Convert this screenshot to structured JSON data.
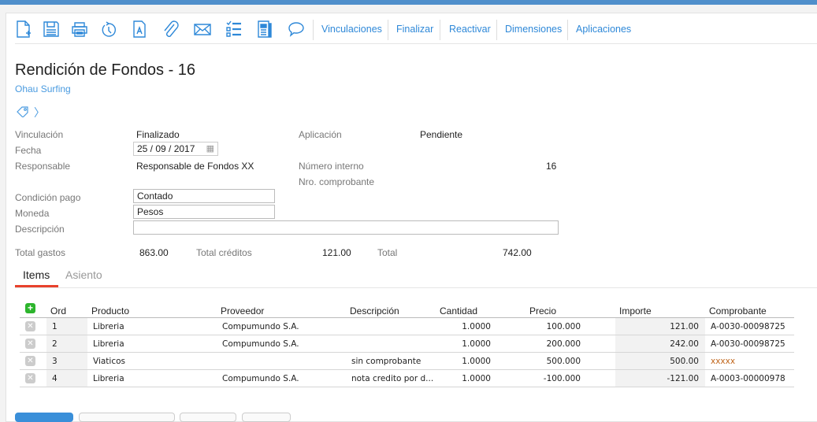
{
  "toolbar": {
    "icons": [
      "new-document-icon",
      "save-icon",
      "print-icon",
      "history-icon",
      "document-text-icon",
      "attachment-icon",
      "email-icon",
      "checklist-icon",
      "report-icon",
      "comment-icon"
    ],
    "links": [
      "Vinculaciones",
      "Finalizar",
      "Reactivar",
      "Dimensiones",
      "Aplicaciones"
    ]
  },
  "header": {
    "title": "Rendición de Fondos - 16",
    "subtitle": "Ohau Surfing"
  },
  "fields": {
    "vinculacion_label": "Vinculación",
    "vinculacion": "Finalizado",
    "fecha_label": "Fecha",
    "fecha": "25 / 09 / 2017",
    "responsable_label": "Responsable",
    "responsable": "Responsable de Fondos XX",
    "aplicacion_label": "Aplicación",
    "aplicacion": "Pendiente",
    "numero_label": "Número interno",
    "numero": "16",
    "comprobante_label": "Nro. comprobante",
    "condicion_label": "Condición pago",
    "condicion": "Contado",
    "moneda_label": "Moneda",
    "moneda": "Pesos",
    "descripcion_label": "Descripción",
    "descripcion": ""
  },
  "totals": {
    "gastos_label": "Total gastos",
    "gastos": "863.00",
    "creditos_label": "Total créditos",
    "creditos": "121.00",
    "total_label": "Total",
    "total": "742.00"
  },
  "tabs": [
    "Items",
    "Asiento"
  ],
  "table": {
    "headers": [
      "Ord",
      "Producto",
      "Proveedor",
      "Descripción",
      "Cantidad",
      "Precio",
      "Importe",
      "Comprobante"
    ],
    "rows": [
      [
        "1",
        "Libreria",
        "Compumundo S.A.",
        "",
        "1.0000",
        "100.000",
        "121.00",
        "A-0030-00098725"
      ],
      [
        "2",
        "Libreria",
        "Compumundo S.A.",
        "",
        "1.0000",
        "200.000",
        "242.00",
        "A-0030-00098725"
      ],
      [
        "3",
        "Viaticos",
        "",
        "sin comprobante",
        "1.0000",
        "500.000",
        "500.00",
        "xxxxx"
      ],
      [
        "4",
        "Libreria",
        "Compumundo S.A.",
        "nota credito por d...",
        "1.0000",
        "-100.000",
        "-121.00",
        "A-0003-00000978"
      ]
    ]
  },
  "colors": {
    "accent": "#2e88d8",
    "topbar": "#4f8fcb",
    "tab_underline": "#e8412c",
    "placeholder_comprobante": "#c0651a"
  }
}
